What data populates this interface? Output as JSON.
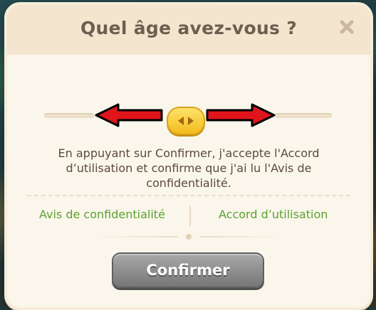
{
  "dialog": {
    "title": "Quel âge avez-vous ?",
    "close_icon": "close-x-icon",
    "slider": {
      "handle_icon": "left-right-arrows-icon",
      "left_arrow_icon": "red-left-arrow-icon",
      "right_arrow_icon": "red-right-arrow-icon"
    },
    "message": "En appuyant sur Confirmer, j'accepte l'Accord d’utilisation et confirme que j'ai lu l'Avis de confidentialité.",
    "links": {
      "privacy_label": "Avis de confidentialité",
      "terms_label": "Accord d’utilisation"
    },
    "confirm_label": "Confirmer"
  },
  "colors": {
    "title_text": "#6e5e50",
    "link": "#5aa22e",
    "handle": "#f4bb1d",
    "arrow_fill": "#e0151b",
    "button": "#8d8d8d"
  }
}
